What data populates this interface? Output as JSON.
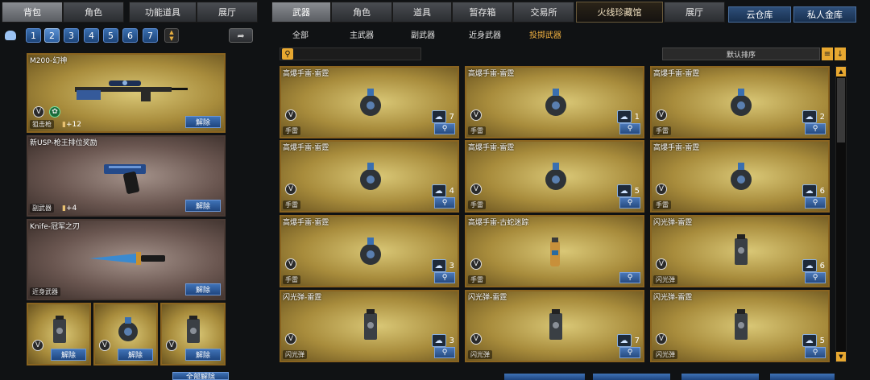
{
  "left_tabs": [
    "背包",
    "角色",
    "功能道具",
    "展厅"
  ],
  "right_tabs": [
    "武器",
    "角色",
    "道具",
    "暂存箱",
    "交易所",
    "火线珍藏馆",
    "展厅"
  ],
  "bank_tabs": [
    "云仓库",
    "私人金库"
  ],
  "pages": [
    "1",
    "2",
    "3",
    "4",
    "5",
    "6",
    "7"
  ],
  "sub_tabs": [
    "全部",
    "主武器",
    "副武器",
    "近身武器",
    "投掷武器"
  ],
  "sort_label": "默认排序",
  "loadout": [
    {
      "name": "M200-幻神",
      "category": "狙击枪",
      "bonus": "+12",
      "action": "解除"
    },
    {
      "name": "新USP-枪王排位奖励",
      "category": "副武器",
      "bonus": "+4",
      "action": "解除"
    },
    {
      "name": "Knife-冠军之刃",
      "category": "近身武器",
      "bonus": "",
      "action": "解除"
    }
  ],
  "throw_slots": [
    {
      "action": "解除"
    },
    {
      "action": "解除"
    },
    {
      "action": "解除"
    }
  ],
  "bottom_buttons": {
    "unequip_all": "全部解除"
  },
  "items": [
    {
      "name": "高爆手雷-雷霆",
      "category": "手雷",
      "count": "7"
    },
    {
      "name": "高爆手雷-雷霆",
      "category": "手雷",
      "count": "1"
    },
    {
      "name": "高爆手雷-雷霆",
      "category": "手雷",
      "count": "2"
    },
    {
      "name": "高爆手雷-雷霆",
      "category": "手雷",
      "count": "4"
    },
    {
      "name": "高爆手雷-雷霆",
      "category": "手雷",
      "count": "5"
    },
    {
      "name": "高爆手雷-雷霆",
      "category": "手雷",
      "count": "6"
    },
    {
      "name": "高爆手雷-雷霆",
      "category": "手雷",
      "count": "3"
    },
    {
      "name": "高爆手雷-古蛇迷踪",
      "category": "手雷",
      "count": ""
    },
    {
      "name": "闪光弹-雷霆",
      "category": "闪光弹",
      "count": "6"
    },
    {
      "name": "闪光弹-雷霆",
      "category": "闪光弹",
      "count": "3"
    },
    {
      "name": "闪光弹-雷霆",
      "category": "闪光弹",
      "count": "7"
    },
    {
      "name": "闪光弹-雷霆",
      "category": "闪光弹",
      "count": "5"
    }
  ]
}
